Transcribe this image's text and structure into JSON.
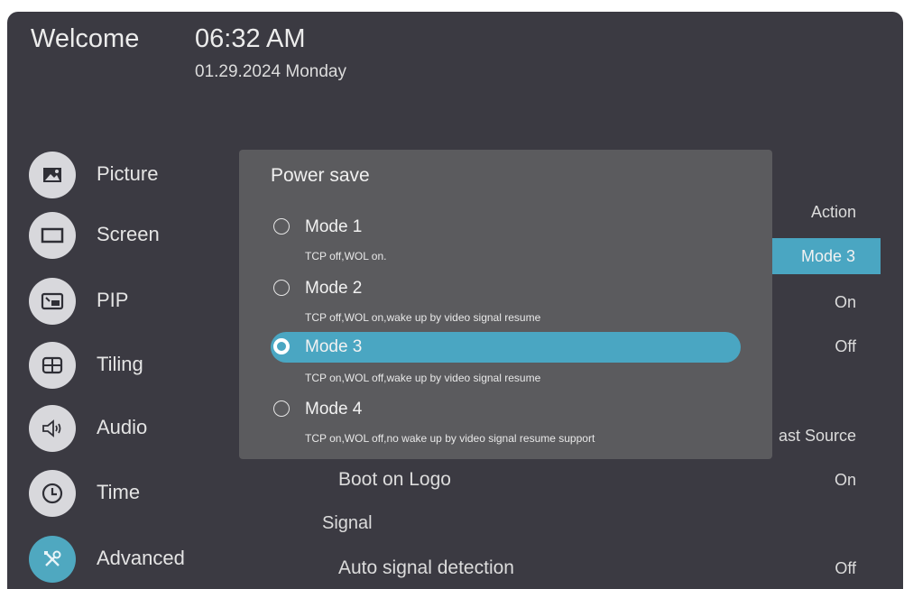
{
  "header": {
    "welcome": "Welcome",
    "time": "06:32 AM",
    "date": "01.29.2024 Monday"
  },
  "sidebar": {
    "items": [
      {
        "label": "Picture",
        "icon": "picture-icon"
      },
      {
        "label": "Screen",
        "icon": "screen-icon"
      },
      {
        "label": "PIP",
        "icon": "pip-icon"
      },
      {
        "label": "Tiling",
        "icon": "tiling-icon"
      },
      {
        "label": "Audio",
        "icon": "speaker-icon"
      },
      {
        "label": "Time",
        "icon": "clock-icon"
      },
      {
        "label": "Advanced",
        "icon": "tools-icon",
        "active": true
      }
    ]
  },
  "background_settings": {
    "values": [
      "Action",
      "Mode 3",
      "On",
      "Off",
      "ast Source",
      "On",
      "Off"
    ],
    "boot_on_logo": "Boot on Logo",
    "signal_section": "Signal",
    "auto_signal_detection": "Auto signal detection"
  },
  "dialog": {
    "title": "Power save",
    "options": [
      {
        "label": "Mode 1",
        "description": "TCP off,WOL on."
      },
      {
        "label": "Mode 2",
        "description": "TCP off,WOL on,wake up by video signal resume"
      },
      {
        "label": "Mode 3",
        "description": "TCP on,WOL off,wake up by video signal resume",
        "selected": true
      },
      {
        "label": "Mode 4",
        "description": "TCP on,WOL off,no wake up by video signal resume support"
      }
    ]
  },
  "colors": {
    "background": "#3b3a42",
    "dialog": "#5b5b5e",
    "accent": "#4aa6c2",
    "icon_bg": "#d8d8dc"
  }
}
